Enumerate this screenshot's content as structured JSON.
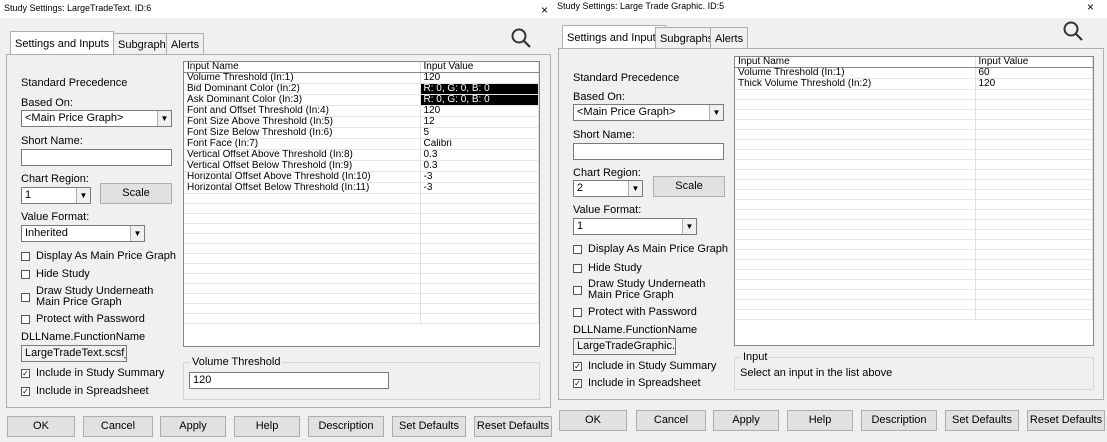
{
  "win1": {
    "title": "Study Settings: LargeTradeText. ID:6",
    "tabs": [
      "Settings and Inputs",
      "Subgraphs",
      "Alerts"
    ],
    "standard_precedence": "Standard Precedence",
    "based_on_label": "Based On:",
    "based_on_value": "<Main Price Graph>",
    "short_name_label": "Short Name:",
    "short_name_value": "",
    "chart_region_label": "Chart Region:",
    "chart_region_value": "1",
    "scale_label": "Scale",
    "value_format_label": "Value Format:",
    "value_format_value": "Inherited",
    "checks": [
      {
        "label": "Display As Main Price Graph",
        "checked": false
      },
      {
        "label": "Hide Study",
        "checked": false
      },
      {
        "label": "Draw Study Underneath",
        "label2": "Main Price Graph",
        "checked": false
      },
      {
        "label": "Protect with Password",
        "checked": false
      }
    ],
    "dll_label": "DLLName.FunctionName",
    "dll_value": "LargeTradeText.scsf_l",
    "include_summary": "Include in Study Summary",
    "include_spreadsheet": "Include in Spreadsheet",
    "grid_headers": [
      "Input Name",
      "Input Value"
    ],
    "grid_rows": [
      [
        "Volume Threshold  (In:1)",
        "120"
      ],
      [
        "Bid Dominant Color  (In:2)",
        "R: 0, G: 0, B: 0"
      ],
      [
        "Ask Dominant Color  (In:3)",
        "R: 0, G: 0, B: 0"
      ],
      [
        "Font and Offset Threshold  (In:4)",
        "120"
      ],
      [
        "Font Size Above Threshold  (In:5)",
        "12"
      ],
      [
        "Font Size Below Threshold  (In:6)",
        "5"
      ],
      [
        "Font Face  (In:7)",
        "Calibri"
      ],
      [
        "Vertical Offset Above Threshold  (In:8)",
        "0.3"
      ],
      [
        "Vertical Offset Below Threshold  (In:9)",
        "0.3"
      ],
      [
        "Horizontal Offset Above Threshold  (In:10)",
        "-3"
      ],
      [
        "Horizontal Offset Below Threshold  (In:11)",
        "-3"
      ]
    ],
    "input_group_title": "Volume Threshold",
    "input_group_value": "120",
    "buttons": [
      "OK",
      "Cancel",
      "Apply",
      "Help",
      "Description",
      "Set Defaults",
      "Reset Defaults"
    ]
  },
  "win2": {
    "title": "Study Settings: Large Trade Graphic. ID:5",
    "close": "×",
    "tabs": [
      "Settings and Inputs",
      "Subgraphs",
      "Alerts"
    ],
    "standard_precedence": "Standard Precedence",
    "based_on_label": "Based On:",
    "based_on_value": "<Main Price Graph>",
    "short_name_label": "Short Name:",
    "short_name_value": "",
    "chart_region_label": "Chart Region:",
    "chart_region_value": "2",
    "scale_label": "Scale",
    "value_format_label": "Value Format:",
    "value_format_value": "1",
    "checks": [
      {
        "label": "Display As Main Price Graph",
        "checked": false
      },
      {
        "label": "Hide Study",
        "checked": false
      },
      {
        "label": "Draw Study Underneath",
        "label2": "Main Price Graph",
        "checked": false
      },
      {
        "label": "Protect with Password",
        "checked": false
      }
    ],
    "dll_label": "DLLName.FunctionName",
    "dll_value": "LargeTradeGraphic.sc",
    "include_summary": "Include in Study Summary",
    "include_spreadsheet": "Include in Spreadsheet",
    "grid_headers": [
      "Input Name",
      "Input Value"
    ],
    "grid_rows": [
      [
        "Volume Threshold  (In:1)",
        "60"
      ],
      [
        "Thick Volume Threshold  (In:2)",
        "120"
      ]
    ],
    "input_group_title": "Input",
    "input_group_text": "Select an input in the list above",
    "buttons": [
      "OK",
      "Cancel",
      "Apply",
      "Help",
      "Description",
      "Set Defaults",
      "Reset Defaults"
    ]
  },
  "close_between": "×"
}
